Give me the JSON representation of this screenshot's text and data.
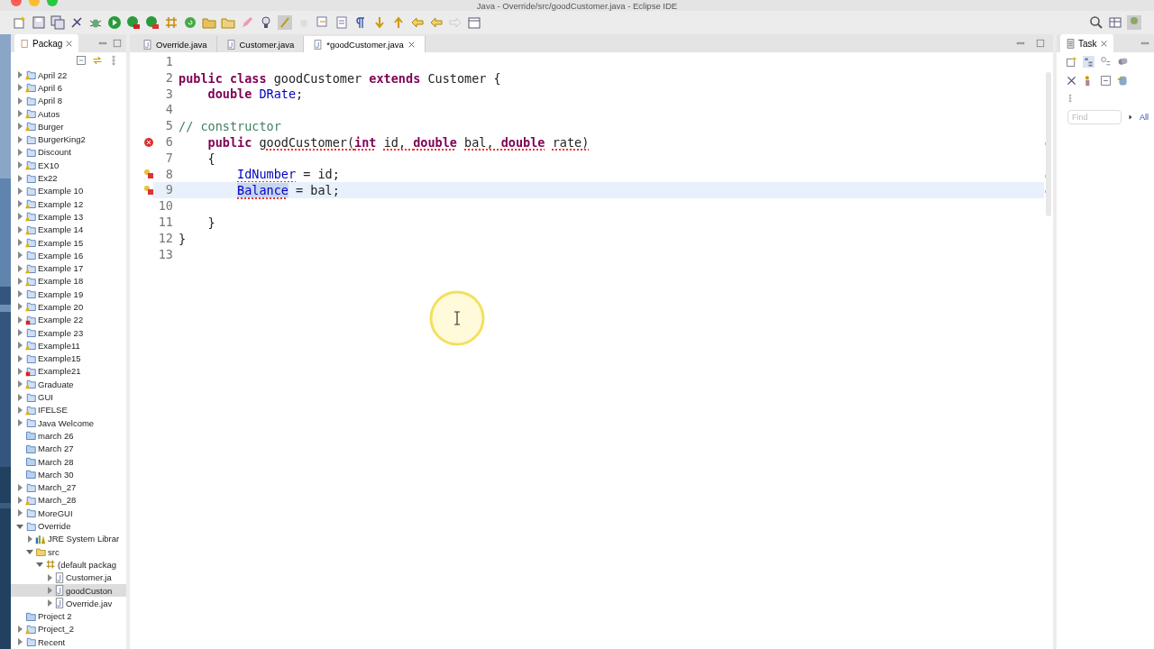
{
  "window": {
    "title": "Java - Override/src/goodCustomer.java - Eclipse IDE"
  },
  "explorer": {
    "title": "Packag",
    "items": [
      {
        "label": "April 22",
        "kind": "project",
        "warning": true,
        "error": false,
        "expanded": false,
        "selected": false
      },
      {
        "label": "April 6",
        "kind": "project",
        "warning": true,
        "error": false,
        "expanded": false,
        "selected": false
      },
      {
        "label": "April 8",
        "kind": "project",
        "warning": false,
        "error": false,
        "expanded": false,
        "selected": false
      },
      {
        "label": "Autos",
        "kind": "project",
        "warning": true,
        "error": false,
        "expanded": false,
        "selected": false
      },
      {
        "label": "Burger",
        "kind": "project",
        "warning": true,
        "error": false,
        "expanded": false,
        "selected": false
      },
      {
        "label": "BurgerKing2",
        "kind": "project",
        "warning": false,
        "error": false,
        "expanded": false,
        "selected": false
      },
      {
        "label": "Discount",
        "kind": "project",
        "warning": false,
        "error": false,
        "expanded": false,
        "selected": false
      },
      {
        "label": "EX10",
        "kind": "project",
        "warning": true,
        "error": false,
        "expanded": false,
        "selected": false
      },
      {
        "label": "Ex22",
        "kind": "project",
        "warning": false,
        "error": false,
        "expanded": false,
        "selected": false
      },
      {
        "label": "Example 10",
        "kind": "project",
        "warning": false,
        "error": false,
        "expanded": false,
        "selected": false
      },
      {
        "label": "Example 12",
        "kind": "project",
        "warning": true,
        "error": false,
        "expanded": false,
        "selected": false
      },
      {
        "label": "Example 13",
        "kind": "project",
        "warning": true,
        "error": false,
        "expanded": false,
        "selected": false
      },
      {
        "label": "Example 14",
        "kind": "project",
        "warning": true,
        "error": false,
        "expanded": false,
        "selected": false
      },
      {
        "label": "Example 15",
        "kind": "project",
        "warning": true,
        "error": false,
        "expanded": false,
        "selected": false
      },
      {
        "label": "Example 16",
        "kind": "project",
        "warning": false,
        "error": false,
        "expanded": false,
        "selected": false
      },
      {
        "label": "Example 17",
        "kind": "project",
        "warning": true,
        "error": false,
        "expanded": false,
        "selected": false
      },
      {
        "label": "Example 18",
        "kind": "project",
        "warning": true,
        "error": false,
        "expanded": false,
        "selected": false
      },
      {
        "label": "Example 19",
        "kind": "project",
        "warning": false,
        "error": false,
        "expanded": false,
        "selected": false
      },
      {
        "label": "Example 20",
        "kind": "project",
        "warning": true,
        "error": false,
        "expanded": false,
        "selected": false
      },
      {
        "label": "Example 22",
        "kind": "project",
        "warning": false,
        "error": true,
        "expanded": false,
        "selected": false
      },
      {
        "label": "Example 23",
        "kind": "project",
        "warning": false,
        "error": false,
        "expanded": false,
        "selected": false
      },
      {
        "label": "Example11",
        "kind": "project",
        "warning": true,
        "error": false,
        "expanded": false,
        "selected": false
      },
      {
        "label": "Example15",
        "kind": "project",
        "warning": false,
        "error": false,
        "expanded": false,
        "selected": false
      },
      {
        "label": "Example21",
        "kind": "project",
        "warning": false,
        "error": true,
        "expanded": false,
        "selected": false
      },
      {
        "label": "Graduate",
        "kind": "project",
        "warning": true,
        "error": false,
        "expanded": false,
        "selected": false
      },
      {
        "label": "GUI",
        "kind": "project",
        "warning": false,
        "error": false,
        "expanded": false,
        "selected": false
      },
      {
        "label": "IFELSE",
        "kind": "project",
        "warning": true,
        "error": false,
        "expanded": false,
        "selected": false
      },
      {
        "label": "Java Welcome",
        "kind": "project",
        "warning": false,
        "error": false,
        "expanded": false,
        "selected": false
      },
      {
        "label": "march 26",
        "kind": "folder",
        "selected": false
      },
      {
        "label": "March 27",
        "kind": "folder",
        "selected": false
      },
      {
        "label": "March 28",
        "kind": "folder",
        "selected": false
      },
      {
        "label": "March 30",
        "kind": "folder",
        "selected": false
      },
      {
        "label": "March_27",
        "kind": "project",
        "warning": false,
        "error": false,
        "expanded": false,
        "selected": false
      },
      {
        "label": "March_28",
        "kind": "project",
        "warning": true,
        "error": false,
        "expanded": false,
        "selected": false
      },
      {
        "label": "MoreGUI",
        "kind": "project",
        "warning": false,
        "error": false,
        "expanded": false,
        "selected": false
      },
      {
        "label": "Override",
        "kind": "project",
        "warning": false,
        "error": false,
        "expanded": true,
        "selected": false,
        "children": [
          {
            "label": "JRE System Librar",
            "kind": "library",
            "expanded": false,
            "selected": false
          },
          {
            "label": "src",
            "kind": "source",
            "expanded": true,
            "selected": false,
            "children": [
              {
                "label": "(default packag",
                "kind": "package",
                "expanded": true,
                "selected": false,
                "children": [
                  {
                    "label": "Customer.ja",
                    "kind": "file",
                    "expanded": false,
                    "selected": false
                  },
                  {
                    "label": "goodCuston",
                    "kind": "file",
                    "expanded": false,
                    "selected": true
                  },
                  {
                    "label": "Override.jav",
                    "kind": "file",
                    "expanded": false,
                    "selected": false
                  }
                ]
              }
            ]
          }
        ]
      },
      {
        "label": "Project 2",
        "kind": "folder",
        "selected": false
      },
      {
        "label": "Project_2",
        "kind": "project",
        "warning": true,
        "error": false,
        "expanded": false,
        "selected": false
      },
      {
        "label": "Recent",
        "kind": "project",
        "warning": false,
        "error": false,
        "expanded": false,
        "selected": false
      }
    ]
  },
  "editor": {
    "tabs": [
      {
        "label": "Override.java",
        "selected": false
      },
      {
        "label": "Customer.java",
        "selected": false
      },
      {
        "label": "*goodCustomer.java",
        "selected": true
      }
    ],
    "lines": [
      {
        "number": "1",
        "error": false,
        "quick_fix": false,
        "current": false
      },
      {
        "number": "2",
        "error": false,
        "quick_fix": false,
        "current": false,
        "tokens": [
          {
            "text": "public class",
            "kind": "kw",
            "error": false
          },
          {
            "text": " goodCustomer ",
            "kind": "plain",
            "error": false
          },
          {
            "text": "extends",
            "kind": "kw",
            "error": false
          },
          {
            "text": " Customer {",
            "kind": "plain",
            "error": false
          }
        ]
      },
      {
        "number": "3",
        "error": false,
        "quick_fix": false,
        "current": false,
        "tokens": [
          {
            "text": "    double",
            "kind": "kw",
            "error": false
          },
          {
            "text": " DRate",
            "kind": "field",
            "error": false
          },
          {
            "text": ";",
            "kind": "plain",
            "error": false
          }
        ]
      },
      {
        "number": "4",
        "error": false,
        "quick_fix": false,
        "current": false
      },
      {
        "number": "5",
        "error": false,
        "quick_fix": false,
        "current": false,
        "tokens": [
          {
            "text": "// constructor",
            "kind": "comment",
            "error": false
          }
        ]
      },
      {
        "number": "6",
        "error": true,
        "quick_fix": false,
        "current": false,
        "tokens": [
          {
            "text": "    public",
            "kind": "kw",
            "error": false
          },
          {
            "text": " goodCustomer(",
            "kind": "plain",
            "error": true
          },
          {
            "text": "int",
            "kind": "kw",
            "error": true
          },
          {
            "text": " id, ",
            "kind": "plain",
            "error": true
          },
          {
            "text": "double",
            "kind": "kw",
            "error": true
          },
          {
            "text": " bal, ",
            "kind": "plain",
            "error": true
          },
          {
            "text": "double",
            "kind": "kw",
            "error": true
          },
          {
            "text": " rate)",
            "kind": "plain",
            "error": true
          }
        ]
      },
      {
        "number": "7",
        "error": false,
        "quick_fix": false,
        "current": false,
        "tokens": [
          {
            "text": "    {",
            "kind": "plain",
            "error": false
          }
        ]
      },
      {
        "number": "8",
        "error": false,
        "quick_fix": true,
        "current": false,
        "tokens": [
          {
            "text": "        IdNumber",
            "kind": "field",
            "error": true
          },
          {
            "text": " = id;",
            "kind": "plain",
            "error": false
          }
        ]
      },
      {
        "number": "9",
        "error": false,
        "quick_fix": true,
        "current": true,
        "tokens": [
          {
            "text": "        Balance",
            "kind": "selected",
            "error": true
          },
          {
            "text": " = bal;",
            "kind": "plain",
            "error": false
          }
        ]
      },
      {
        "number": "10",
        "error": false,
        "quick_fix": false,
        "current": false
      },
      {
        "number": "11",
        "error": false,
        "quick_fix": false,
        "current": false,
        "tokens": [
          {
            "text": "    }",
            "kind": "plain",
            "error": false
          }
        ]
      },
      {
        "number": "12",
        "error": false,
        "quick_fix": false,
        "current": false,
        "tokens": [
          {
            "text": "}",
            "kind": "plain",
            "error": false
          }
        ]
      },
      {
        "number": "13",
        "error": false,
        "quick_fix": false,
        "current": false
      }
    ]
  },
  "tasks": {
    "title": "Task",
    "find": {
      "placeholder": "Find"
    },
    "filter": "All"
  }
}
